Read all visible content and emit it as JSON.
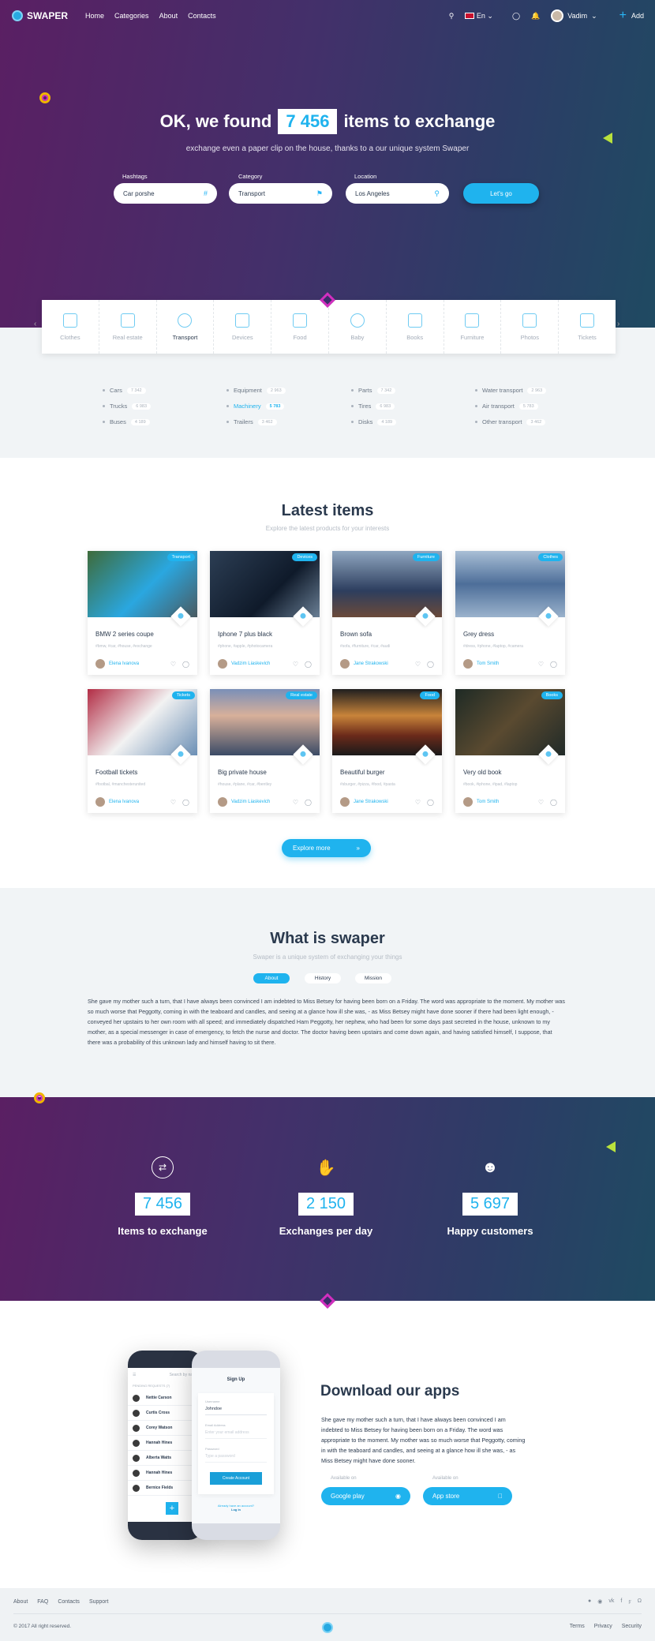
{
  "nav": {
    "brand": "SWAPER",
    "links": [
      "Home",
      "Categories",
      "About",
      "Contacts"
    ],
    "language": "En",
    "user": "Vadim",
    "add": "Add"
  },
  "hero": {
    "title_before": "OK, we found",
    "count": "7 456",
    "title_after": "items to exchange",
    "subtitle": "exchange even a paper clip on the house, thanks to a our unique system Swaper",
    "fields": [
      {
        "label": "Hashtags",
        "value": "Car porshe",
        "icon": "hash-icon"
      },
      {
        "label": "Category",
        "value": "Transport",
        "icon": "tag-icon"
      },
      {
        "label": "Location",
        "value": "Los Angeles",
        "icon": "pin-icon"
      }
    ],
    "submit": "Let's go"
  },
  "categories": {
    "items": [
      "Clothes",
      "Real estate",
      "Transport",
      "Devices",
      "Food",
      "Baby",
      "Books",
      "Furniture",
      "Photos",
      "Tickets"
    ],
    "active": "Transport",
    "subcategories": [
      [
        {
          "name": "Cars",
          "count": "7 342"
        },
        {
          "name": "Trucks",
          "count": "6 983"
        },
        {
          "name": "Buses",
          "count": "4 189"
        }
      ],
      [
        {
          "name": "Equipment",
          "count": "2 963"
        },
        {
          "name": "Machinery",
          "count": "5 783"
        },
        {
          "name": "Trailers",
          "count": "3 462"
        }
      ],
      [
        {
          "name": "Parts",
          "count": "7 342"
        },
        {
          "name": "Tires",
          "count": "6 983"
        },
        {
          "name": "Disks",
          "count": "4 189"
        }
      ],
      [
        {
          "name": "Water transport",
          "count": "2 963"
        },
        {
          "name": "Air transport",
          "count": "5 783"
        },
        {
          "name": "Other transport",
          "count": "3 462"
        }
      ]
    ]
  },
  "latest": {
    "title": "Latest items",
    "subtitle": "Explore the latest products for your interests",
    "explore": "Explore more",
    "cards": [
      {
        "title": "BMW 2 series coupe",
        "badge": "Transport",
        "tags": "#bmw, #car, #house, #exchange",
        "user": "Elena Ivanova"
      },
      {
        "title": "Iphone 7 plus black",
        "badge": "Devices",
        "tags": "#phone, #apple, #photocamera",
        "user": "Vadzim Liaskevich"
      },
      {
        "title": "Brown sofa",
        "badge": "Furniture",
        "tags": "#sofa, #furniture, #car, #audi",
        "user": "Jane Strakowski"
      },
      {
        "title": "Grey dress",
        "badge": "Clothes",
        "tags": "#dress, #phone, #laptop, #camera",
        "user": "Tom Smith"
      },
      {
        "title": "Football tickets",
        "badge": "Tickets",
        "tags": "#footbal, #manchesterunited",
        "user": "Elena Ivanova"
      },
      {
        "title": "Big private house",
        "badge": "Real estate",
        "tags": "#house, #plane, #car, #bentley",
        "user": "Vadzim Liaskevich"
      },
      {
        "title": "Beautiful burger",
        "badge": "Food",
        "tags": "#sburger, #pizza, #food, #pasta",
        "user": "Jane Strakowski"
      },
      {
        "title": "Very old book",
        "badge": "Books",
        "tags": "#book, #iphone, #ipad, #laptop",
        "user": "Tom Smith"
      }
    ]
  },
  "about": {
    "title": "What is swaper",
    "subtitle": "Swaper is a unique system of exchanging your things",
    "tabs": [
      "About",
      "History",
      "Mission"
    ],
    "active_tab": "About",
    "text": "She gave my mother such a turn, that I have always been convinced I am indebted to Miss Betsey for having been born on a Friday. The word was appropriate to the moment. My mother was so much worse that Peggotty, coming in with the teaboard and candles, and seeing at a glance how ill she was, - as Miss Betsey might have done sooner if there had been light enough, - conveyed her upstairs to her own room with all speed; and immediately dispatched Ham Peggotty, her nephew, who had been for some days past secreted in the house, unknown to my mother, as a special messenger in case of emergency, to fetch the nurse and doctor. The doctor having been upstairs and come down again, and having satisfied himself, I suppose, that there was a probability of this unknown lady and himself having to sit there."
  },
  "stats": [
    {
      "value": "7 456",
      "label": "Items to exchange",
      "icon": "shuffle-icon"
    },
    {
      "value": "2 150",
      "label": "Exchanges per day",
      "icon": "handshake-icon"
    },
    {
      "value": "5 697",
      "label": "Happy customers",
      "icon": "users-icon"
    }
  ],
  "apps": {
    "title": "Download our apps",
    "text": "She gave my mother such a turn, that I have always been convinced I am indebted to Miss Betsey for having been born on a Friday. The word was appropriate to the moment. My mother was so much worse that Peggotty, coming in with the teaboard and candles, and seeing at a glance how ill she was, - as Miss Betsey might have done sooner.",
    "stores": [
      {
        "available": "Available on",
        "label": "Google play",
        "icon": "android-icon"
      },
      {
        "available": "Available on",
        "label": "App store",
        "icon": "apple-icon"
      }
    ],
    "phone_list": {
      "search": "Search by name",
      "pending": "PENDING REQUESTS (7)",
      "people": [
        "Nettie Carson",
        "Curtis Cross",
        "Corey Watson",
        "Hannah Hines",
        "Alberta Watts",
        "Hannah Hines",
        "Bernice Fields"
      ]
    },
    "phone_signup": {
      "title": "Sign Up",
      "username_label": "Username",
      "username": "Johndoe",
      "email_label": "Email Address",
      "email_placeholder": "Enter your email address",
      "password_label": "Password",
      "password_placeholder": "Type a password",
      "button": "Create Account",
      "have_account": "Already have an account?",
      "login": "Log in"
    }
  },
  "footer": {
    "links": [
      "About",
      "FAQ",
      "Contacts",
      "Support"
    ],
    "copyright": "© 2017 All right reserved.",
    "legal": [
      "Terms",
      "Privacy",
      "Security"
    ]
  },
  "colors": {
    "accent": "#1fb3ee",
    "hero_start": "#5a1f63",
    "hero_end": "#1f4a62",
    "text": "#2b3a4e"
  }
}
